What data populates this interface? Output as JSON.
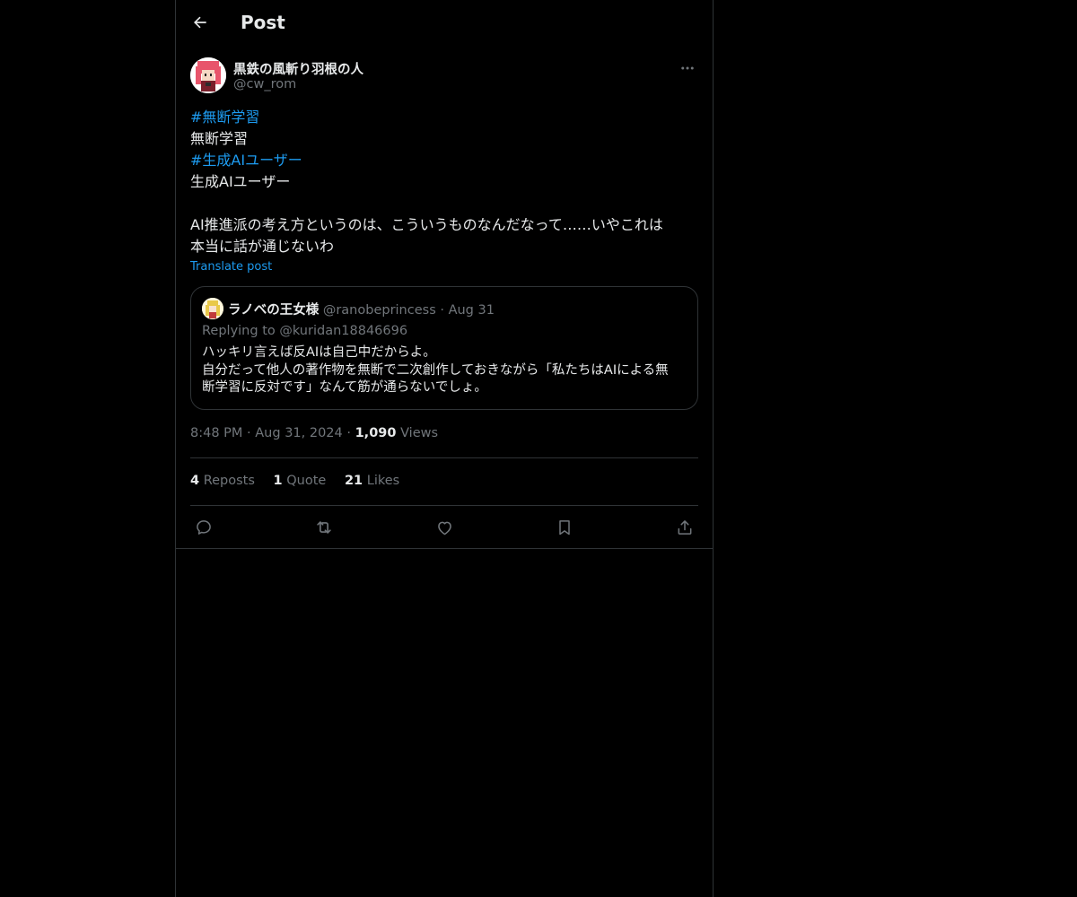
{
  "header": {
    "title": "Post",
    "back_icon": "arrow-left-icon"
  },
  "post": {
    "author_name": "黒鉄の風斬り羽根の人",
    "author_handle": "@cw_rom",
    "body": {
      "hashtag_1": "#無断学習",
      "line_2": "無断学習",
      "hashtag_2": "#生成AIユーザー",
      "line_4": "生成AIユーザー",
      "line_6": "AI推進派の考え方というのは、こういうものなんだなって……いやこれは",
      "line_7": "本当に話が通じないわ"
    },
    "translate_label": "Translate post",
    "time": "8:48 PM",
    "date": "Aug 31, 2024",
    "views_count": "1,090",
    "views_label": "Views",
    "separator": "·"
  },
  "quote": {
    "name": "ラノベの王女様",
    "handle": "@ranobeprincess",
    "date": "Aug 31",
    "replying": "Replying to @kuridan18846696",
    "line_1": "ハッキリ言えば反AIは自己中だからよ。",
    "line_2": "自分だって他人の著作物を無断で二次創作しておきながら「私たちはAIによる無",
    "line_3": "断学習に反対です」なんて筋が通らないでしょ。"
  },
  "stats": {
    "reposts_count": "4",
    "reposts_label": "Reposts",
    "quotes_count": "1",
    "quotes_label": "Quote",
    "likes_count": "21",
    "likes_label": "Likes"
  },
  "actions": [
    "reply-icon",
    "repost-icon",
    "like-icon",
    "bookmark-icon",
    "share-icon"
  ],
  "colors": {
    "background": "#000000",
    "text": "#e7e9ea",
    "muted": "#71767b",
    "accent": "#1d9bf0",
    "border": "#2f3336"
  }
}
